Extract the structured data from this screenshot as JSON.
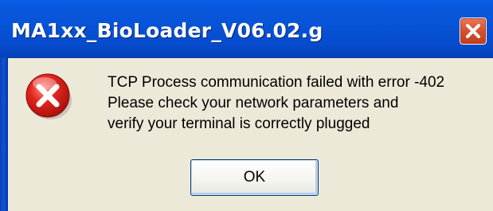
{
  "window": {
    "title": "MA1xx_BioLoader_V06.02.g",
    "close_icon": "close-icon"
  },
  "dialog": {
    "icon": "error-icon",
    "message_lines": [
      "TCP Process communication failed with error -402",
      "Please check your network parameters and",
      "verify your terminal is correctly plugged"
    ],
    "ok_label": "OK"
  },
  "colors": {
    "titlebar": "#0653D6",
    "dialog_background": "#ECE9D8",
    "close_button": "#D9532E",
    "error_icon": "#D61E1E"
  }
}
